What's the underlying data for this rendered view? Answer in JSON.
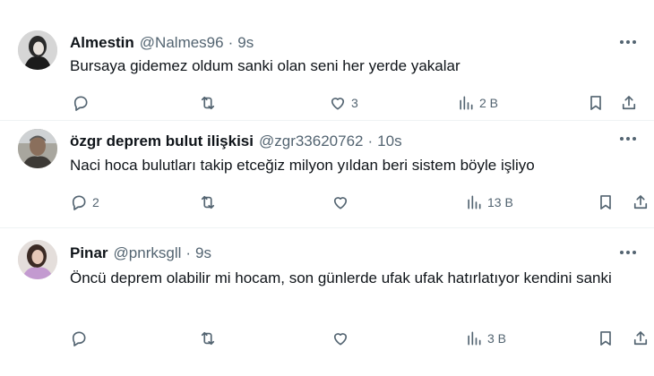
{
  "tweets": [
    {
      "name": "Almestin",
      "handle": "@Nalmes96",
      "time": "9s",
      "text": "Bursaya gidemez oldum sanki  olan seni her yerde yakalar",
      "replies": "",
      "reposts": "",
      "likes": "3",
      "views": "2 B"
    },
    {
      "name": "özgr deprem bulut ilişkisi",
      "handle": "@zgr33620762",
      "time": "10s",
      "text": "Naci hoca bulutları takip etceğiz milyon yıldan beri sistem böyle işliyo",
      "replies": "2",
      "reposts": "",
      "likes": "",
      "views": "13 B"
    },
    {
      "name": "Pinar",
      "handle": "@pnrksgll",
      "time": "9s",
      "text": "Öncü deprem olabilir mi hocam, son günlerde ufak ufak hatırlatıyor kendini sanki",
      "replies": "",
      "reposts": "",
      "likes": "",
      "views": "3 B"
    }
  ],
  "separator": "·",
  "icons": {
    "reply": "reply-icon",
    "repost": "repost-icon",
    "like": "heart-icon",
    "views": "views-chart-icon",
    "bookmark": "bookmark-icon",
    "share": "share-icon",
    "more": "more-dots-icon"
  },
  "colors": {
    "text": "#0f1419",
    "secondary": "#536471",
    "divider": "#eff3f4"
  }
}
